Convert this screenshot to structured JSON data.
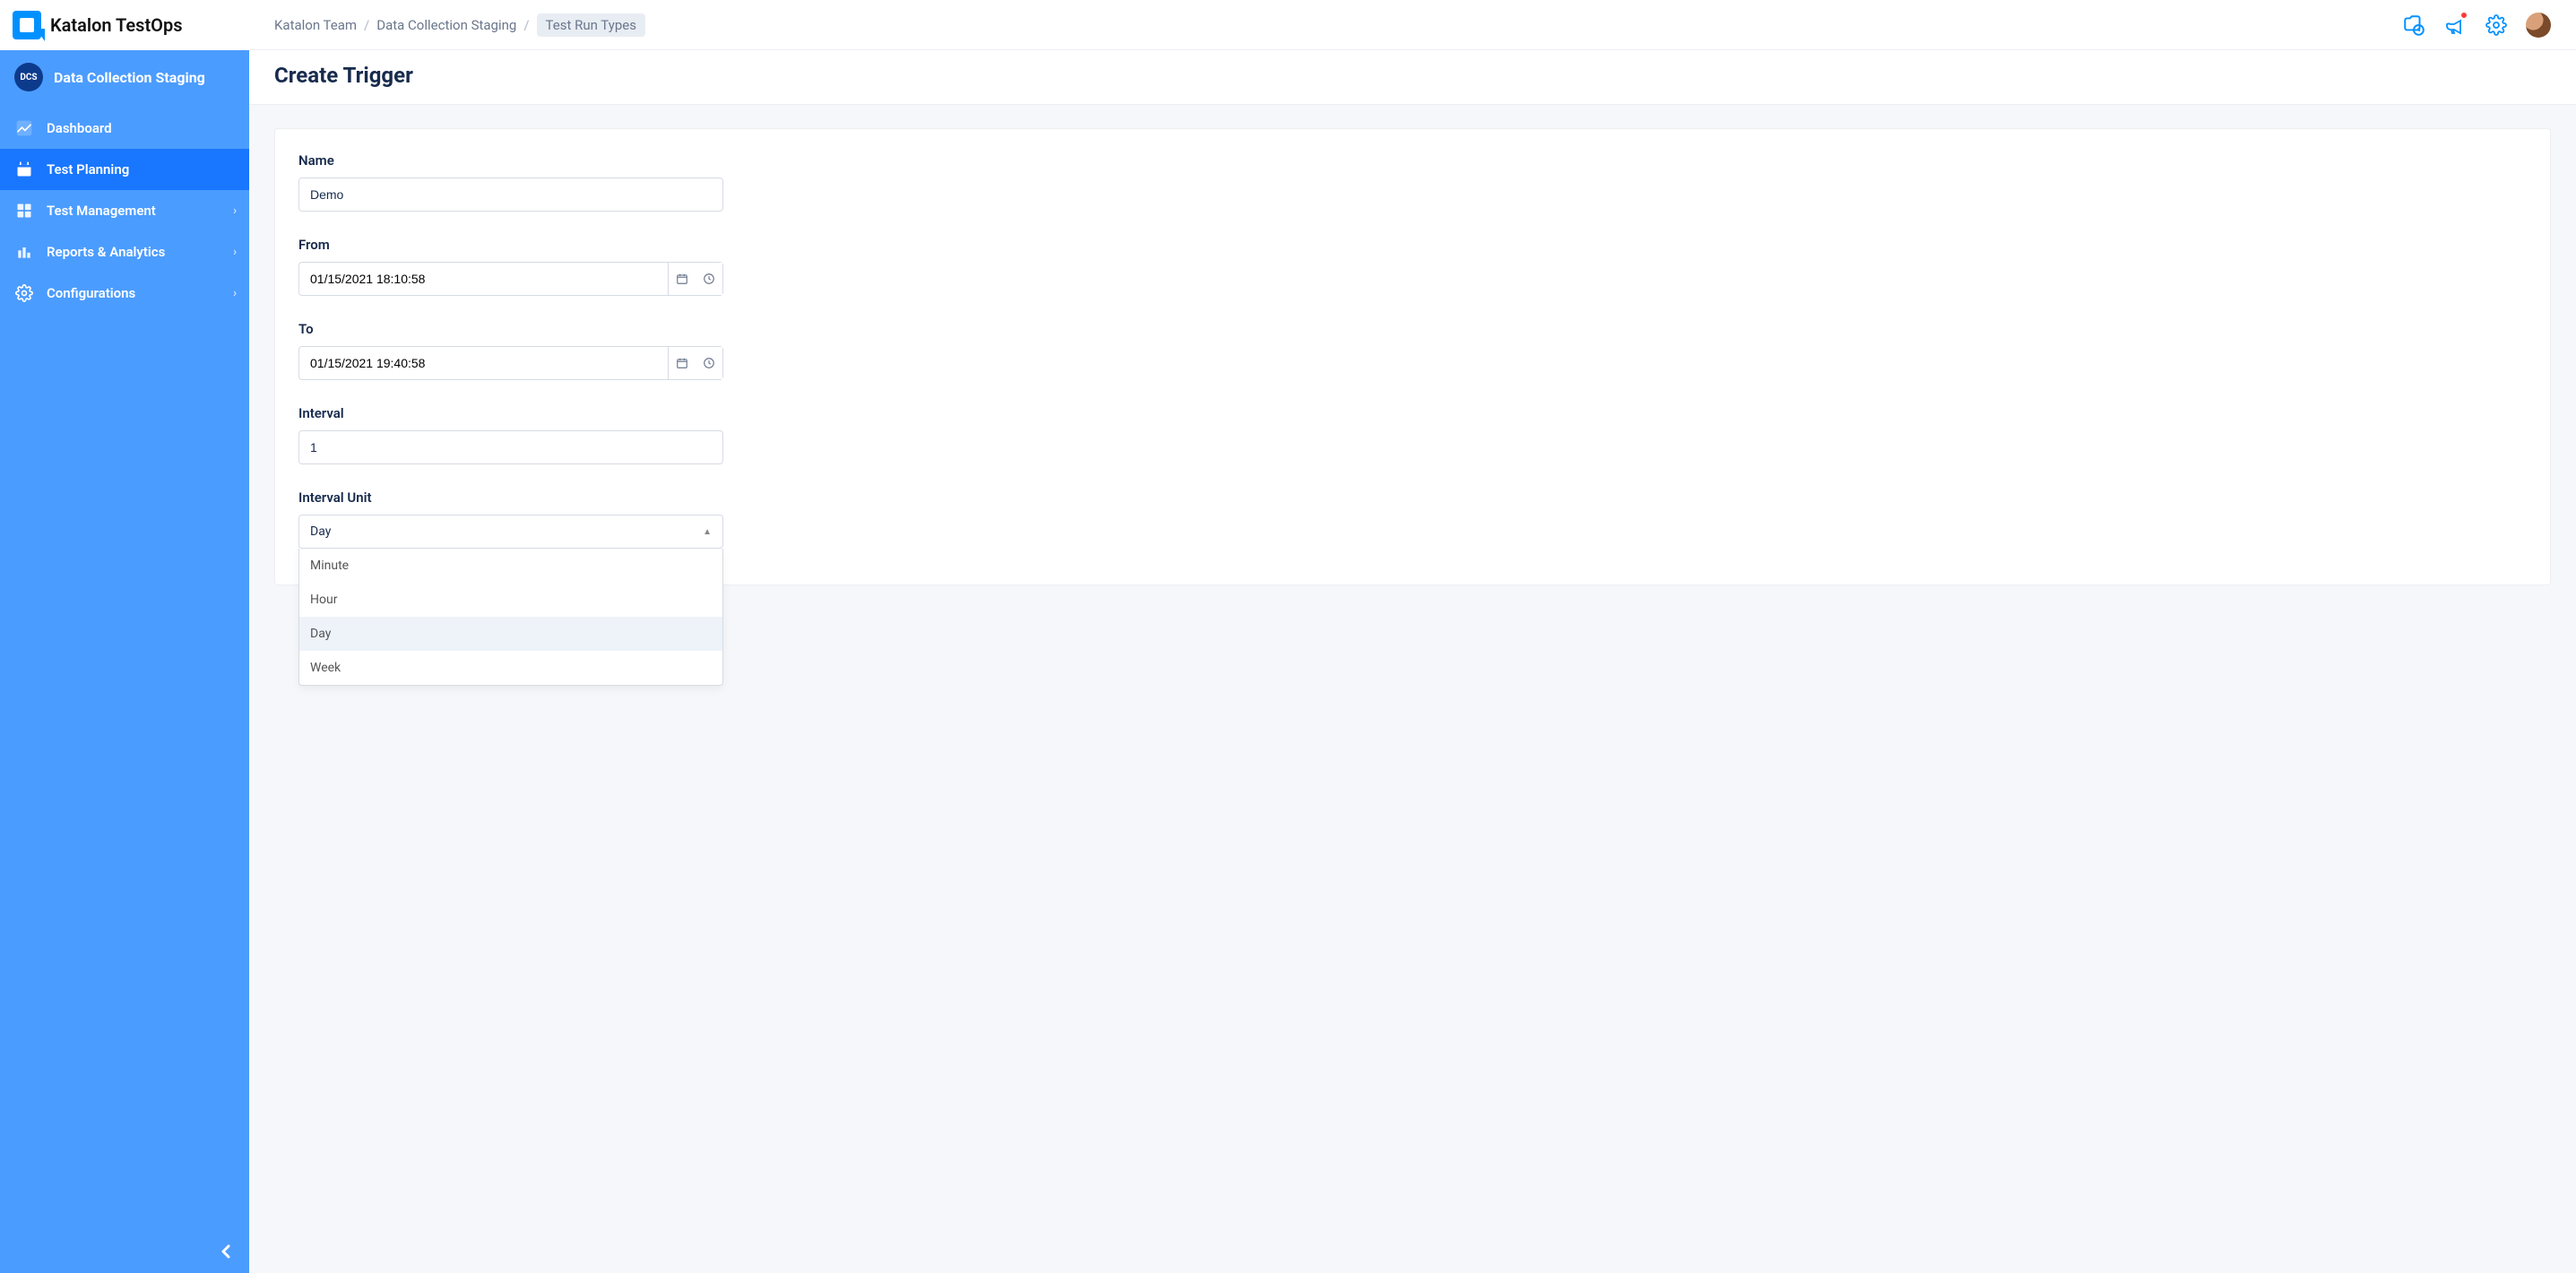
{
  "brand": "Katalon TestOps",
  "project": {
    "badge": "DCS",
    "name": "Data Collection Staging"
  },
  "nav": {
    "items": [
      {
        "label": "Dashboard"
      },
      {
        "label": "Test Planning"
      },
      {
        "label": "Test Management"
      },
      {
        "label": "Reports & Analytics"
      },
      {
        "label": "Configurations"
      }
    ]
  },
  "breadcrumb": {
    "items": [
      "Katalon Team",
      "Data Collection Staging",
      "Test Run Types"
    ]
  },
  "page": {
    "title": "Create Trigger"
  },
  "form": {
    "name": {
      "label": "Name",
      "value": "Demo"
    },
    "from": {
      "label": "From",
      "value": "01/15/2021 18:10:58"
    },
    "to": {
      "label": "To",
      "value": "01/15/2021 19:40:58"
    },
    "interval": {
      "label": "Interval",
      "value": "1"
    },
    "interval_unit": {
      "label": "Interval Unit",
      "value": "Day",
      "options": [
        "Minute",
        "Hour",
        "Day",
        "Week"
      ]
    }
  }
}
